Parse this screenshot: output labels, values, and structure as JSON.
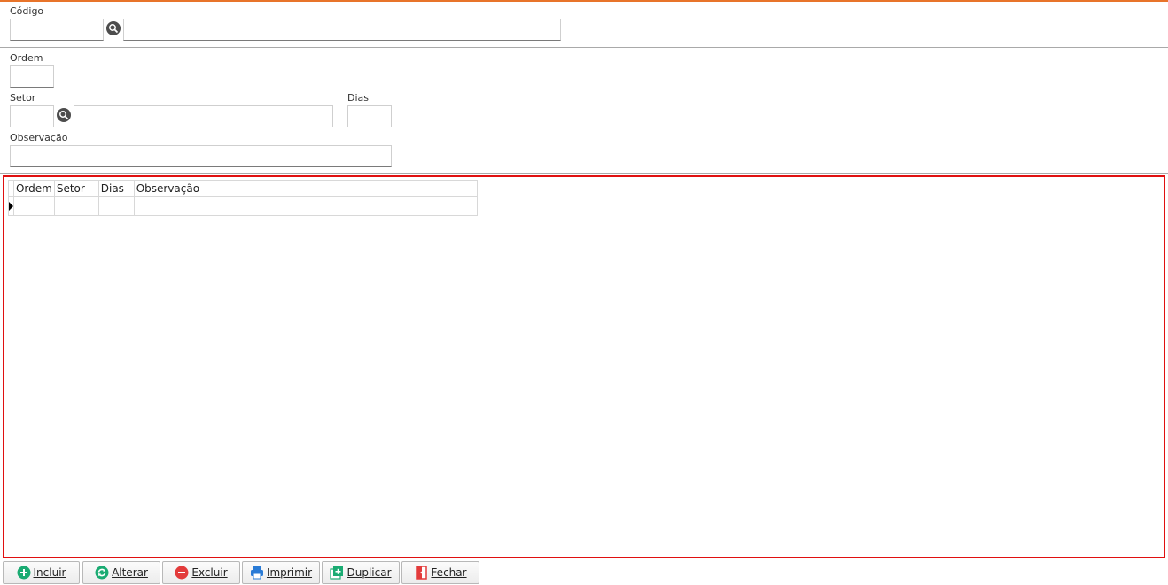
{
  "form": {
    "codigo": {
      "label": "Código",
      "value": "",
      "description": ""
    },
    "ordem": {
      "label": "Ordem",
      "value": ""
    },
    "setor": {
      "label": "Setor",
      "value": "",
      "description": ""
    },
    "dias": {
      "label": "Dias",
      "value": ""
    },
    "observacao": {
      "label": "Observação",
      "value": ""
    }
  },
  "grid": {
    "columns": [
      "Ordem",
      "Setor",
      "Dias",
      "Observação"
    ],
    "rows": [
      [
        "",
        "",
        "",
        ""
      ]
    ]
  },
  "toolbar": {
    "incluir": "Incluir",
    "alterar": "Alterar",
    "excluir": "Excluir",
    "imprimir": "Imprimir",
    "duplicar": "Duplicar",
    "fechar": "Fechar"
  },
  "colors": {
    "accent": "#e8742a",
    "selection_border": "#e01010",
    "incluir_icon": "#1aab72",
    "alterar_icon": "#1aab72",
    "excluir_icon": "#e33b3b",
    "imprimir_icon": "#2a7bd6",
    "duplicar_icon": "#1aab72",
    "fechar_icon": "#e33b3b"
  },
  "icons": {
    "lookup": "magnifier-icon",
    "incluir": "plus-circle-icon",
    "alterar": "refresh-circle-icon",
    "excluir": "minus-circle-icon",
    "imprimir": "printer-icon",
    "duplicar": "duplicate-icon",
    "fechar": "exit-door-icon"
  }
}
